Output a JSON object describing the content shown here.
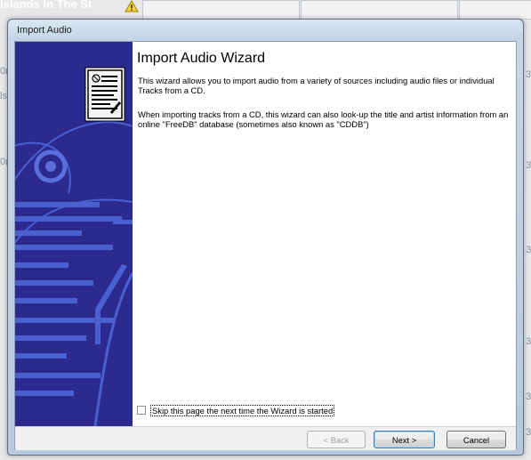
{
  "background": {
    "partial_title": "Islands In The St",
    "left_edge_marks": [
      "0(",
      "ls",
      "0("
    ],
    "right_edge_marks": [
      "3",
      "3",
      "3",
      "3",
      "3",
      "3"
    ]
  },
  "dialog": {
    "title": "Import Audio",
    "heading": "Import Audio Wizard",
    "paragraph1": "This wizard allows you to import audio from a variety of sources including audio files or individual Tracks from a CD.",
    "paragraph2": "When importing tracks from a CD, this wizard can also look-up the title and artist information from an online \"FreeDB\" database (sometimes also known as \"CDDB\")",
    "skip_label": "Skip this page the next time the Wizard is started",
    "skip_checked": false,
    "back_label": "< Back",
    "next_label": "Next >",
    "cancel_label": "Cancel"
  },
  "colors": {
    "side_panel": "#2d2a8f",
    "side_art": "#4a5fd0"
  }
}
